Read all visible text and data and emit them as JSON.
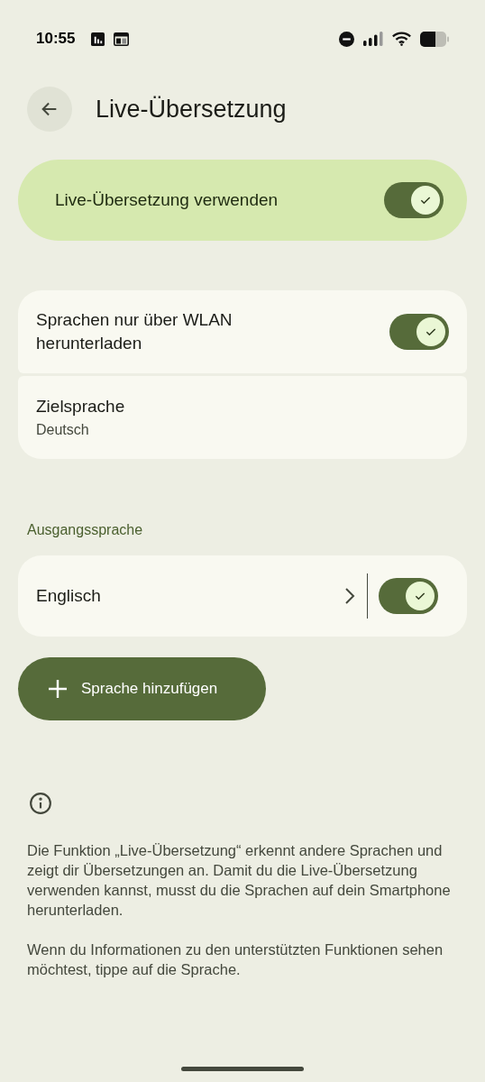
{
  "status_bar": {
    "time": "10:55"
  },
  "header": {
    "title": "Live-Übersetzung"
  },
  "main_toggle": {
    "label": "Live-Übersetzung verwenden",
    "on": true
  },
  "settings": [
    {
      "kind": "toggle",
      "title": "Sprachen nur über WLAN herunterladen",
      "on": true
    },
    {
      "kind": "value",
      "title": "Zielsprache",
      "value": "Deutsch"
    }
  ],
  "source_section": {
    "heading": "Ausgangssprache",
    "languages": [
      {
        "name": "Englisch",
        "on": true
      }
    ]
  },
  "add_button": {
    "label": "Sprache hinzufügen"
  },
  "info": {
    "paragraphs": [
      "Die Funktion „Live-Übersetzung“ erkennt andere Sprachen und zeigt dir Übersetzungen an. Damit du die Live-Übersetzung verwenden kannst, musst du die Sprachen auf dein Smartphone herunterladen.",
      "Wenn du Informationen zu den unterstützten Funktionen sehen möchtest, tippe auf die Sprache."
    ]
  }
}
